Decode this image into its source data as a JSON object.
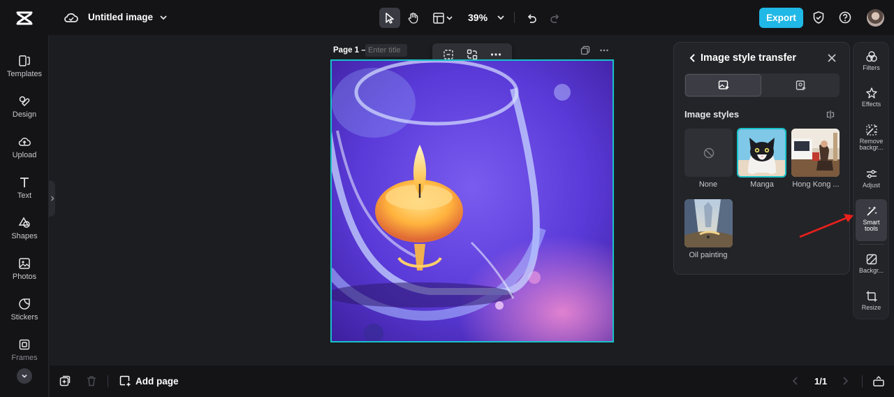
{
  "header": {
    "title": "Untitled image",
    "zoom": "39%",
    "export_label": "Export"
  },
  "sidebar": {
    "items": [
      {
        "label": "Templates",
        "icon": "templates-icon"
      },
      {
        "label": "Design",
        "icon": "design-icon"
      },
      {
        "label": "Upload",
        "icon": "upload-icon"
      },
      {
        "label": "Text",
        "icon": "text-icon"
      },
      {
        "label": "Shapes",
        "icon": "shapes-icon"
      },
      {
        "label": "Photos",
        "icon": "photos-icon"
      },
      {
        "label": "Stickers",
        "icon": "stickers-icon"
      },
      {
        "label": "Frames",
        "icon": "frames-icon"
      }
    ]
  },
  "canvas": {
    "page_label": "Page 1 –",
    "title_placeholder": "Enter title"
  },
  "panel": {
    "title": "Image style transfer",
    "section_label": "Image styles",
    "styles": [
      {
        "name": "None",
        "selected": false
      },
      {
        "name": "Manga",
        "selected": true
      },
      {
        "name": "Hong Kong ...",
        "selected": false
      },
      {
        "name": "Oil painting",
        "selected": false
      }
    ]
  },
  "rail": {
    "items": [
      {
        "label": "Filters",
        "icon": "filters-icon"
      },
      {
        "label": "Effects",
        "icon": "effects-icon"
      },
      {
        "label": "Remove backgr...",
        "icon": "remove-background-icon"
      },
      {
        "label": "Adjust",
        "icon": "adjust-icon"
      },
      {
        "label": "Smart tools",
        "icon": "smart-tools-icon",
        "active": true
      },
      {
        "label": "Backgr...",
        "icon": "background-icon"
      },
      {
        "label": "Resize",
        "icon": "resize-icon"
      }
    ]
  },
  "footer": {
    "add_page_label": "Add page",
    "page_indicator": "1/1"
  },
  "colors": {
    "accent": "#17c2c9",
    "export": "#20b8e6",
    "annotation_arrow": "#e8201c"
  }
}
